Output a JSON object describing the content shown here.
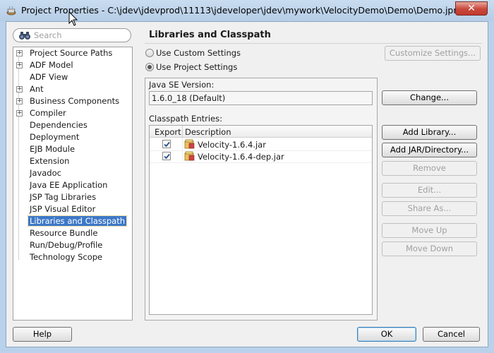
{
  "window": {
    "title": "Project Properties - C:\\jdev\\jdevprod\\11113\\jdeveloper\\jdev\\mywork\\VelocityDemo\\Demo\\Demo.jpr",
    "close_glyph": "✕"
  },
  "search": {
    "placeholder": "Search"
  },
  "nav": {
    "items": [
      {
        "label": "Project Source Paths",
        "expandable": true
      },
      {
        "label": "ADF Model",
        "expandable": true
      },
      {
        "label": "ADF View",
        "expandable": false
      },
      {
        "label": "Ant",
        "expandable": true
      },
      {
        "label": "Business Components",
        "expandable": true
      },
      {
        "label": "Compiler",
        "expandable": true
      },
      {
        "label": "Dependencies",
        "expandable": false
      },
      {
        "label": "Deployment",
        "expandable": false
      },
      {
        "label": "EJB Module",
        "expandable": false
      },
      {
        "label": "Extension",
        "expandable": false
      },
      {
        "label": "Javadoc",
        "expandable": false
      },
      {
        "label": "Java EE Application",
        "expandable": false
      },
      {
        "label": "JSP Tag Libraries",
        "expandable": false
      },
      {
        "label": "JSP Visual Editor",
        "expandable": false
      },
      {
        "label": "Libraries and Classpath",
        "expandable": false,
        "selected": true
      },
      {
        "label": "Resource Bundle",
        "expandable": false
      },
      {
        "label": "Run/Debug/Profile",
        "expandable": false
      },
      {
        "label": "Technology Scope",
        "expandable": false
      }
    ]
  },
  "panel": {
    "title": "Libraries and Classpath",
    "radio_custom": "Use Custom Settings",
    "radio_project": "Use Project Settings",
    "selected_radio": "project",
    "customize_button": "Customize Settings...",
    "java_se_label": "Java SE Version:",
    "java_se_value": "1.6.0_18 (Default)",
    "change_button": "Change...",
    "classpath_label": "Classpath Entries:",
    "col_export": "Export",
    "col_description": "Description",
    "entries": [
      {
        "export": true,
        "name": "Velocity-1.6.4.jar"
      },
      {
        "export": true,
        "name": "Velocity-1.6.4-dep.jar"
      }
    ],
    "buttons": {
      "add_library": "Add Library...",
      "add_jar": "Add JAR/Directory...",
      "remove": "Remove",
      "edit": "Edit...",
      "share_as": "Share As...",
      "move_up": "Move Up",
      "move_down": "Move Down"
    }
  },
  "footer": {
    "help": "Help",
    "ok": "OK",
    "cancel": "Cancel"
  },
  "icons": {
    "app": "jdeveloper-cup-icon",
    "search": "binoculars-icon",
    "jar": "jar-file-icon",
    "check": "checkmark-icon"
  },
  "colors": {
    "selection": "#3d78c8",
    "title_bar": "#b9d1ea",
    "close": "#c8473b"
  }
}
